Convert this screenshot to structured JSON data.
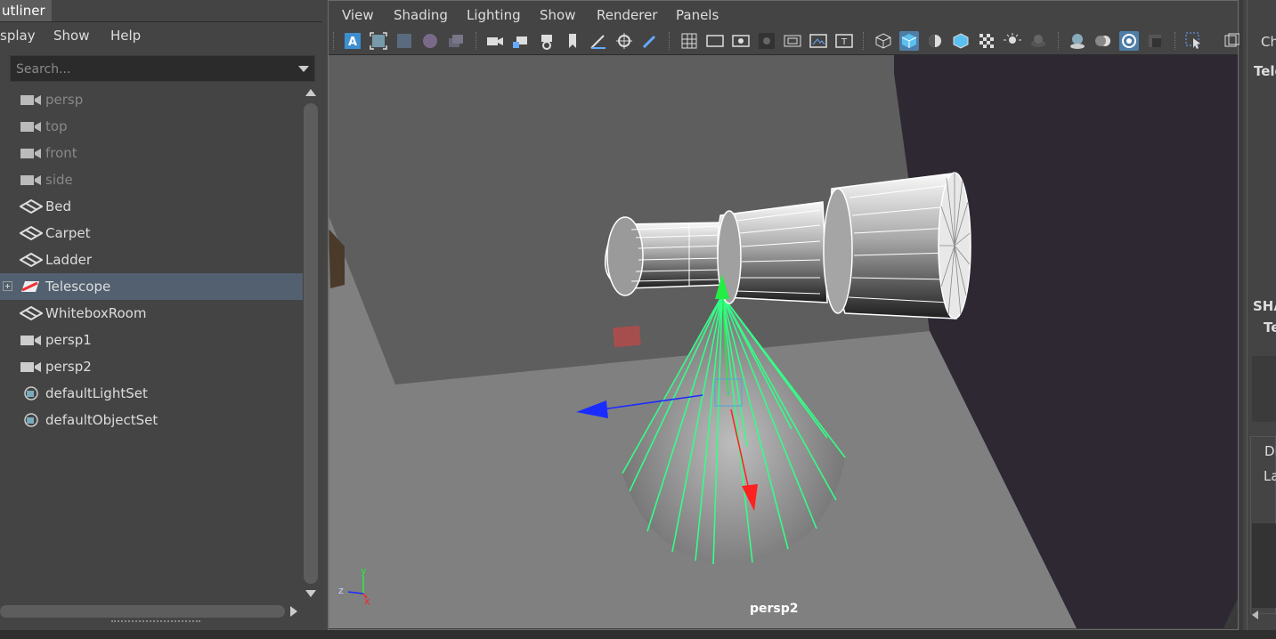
{
  "outliner": {
    "tab_title": "utliner",
    "menus": [
      "splay",
      "Show",
      "Help"
    ],
    "search_placeholder": "Search...",
    "items": [
      {
        "label": "persp",
        "icon": "camera-icon",
        "dim": true
      },
      {
        "label": "top",
        "icon": "camera-icon",
        "dim": true
      },
      {
        "label": "front",
        "icon": "camera-icon",
        "dim": true
      },
      {
        "label": "side",
        "icon": "camera-icon",
        "dim": true
      },
      {
        "label": "Bed",
        "icon": "mesh-icon",
        "dim": false
      },
      {
        "label": "Carpet",
        "icon": "mesh-icon",
        "dim": false
      },
      {
        "label": "Ladder",
        "icon": "mesh-icon",
        "dim": false
      },
      {
        "label": "Telescope",
        "icon": "light-transform-icon",
        "dim": false,
        "selected": true
      },
      {
        "label": "WhiteboxRoom",
        "icon": "mesh-icon",
        "dim": false
      },
      {
        "label": "persp1",
        "icon": "camera-icon",
        "dim": false
      },
      {
        "label": "persp2",
        "icon": "camera-icon",
        "dim": false
      },
      {
        "label": "defaultLightSet",
        "icon": "set-icon",
        "dim": false
      },
      {
        "label": "defaultObjectSet",
        "icon": "set-icon",
        "dim": false
      }
    ]
  },
  "viewport": {
    "menus": [
      "View",
      "Shading",
      "Lighting",
      "Show",
      "Renderer",
      "Panels"
    ],
    "camera_label": "persp2",
    "axis_labels": {
      "x": "x",
      "y": "y",
      "z": "z"
    }
  },
  "right_panel": {
    "texts": [
      "Ch",
      "Tele",
      "SHA",
      "Te",
      "Di",
      "La"
    ]
  },
  "colors": {
    "selection": "#52606f",
    "active_tool": "#4e7ea8",
    "spotlight_cone": "#33ff88",
    "translate_x": "#ff2020",
    "translate_y": "#22ee44",
    "translate_z": "#1a2cff"
  }
}
